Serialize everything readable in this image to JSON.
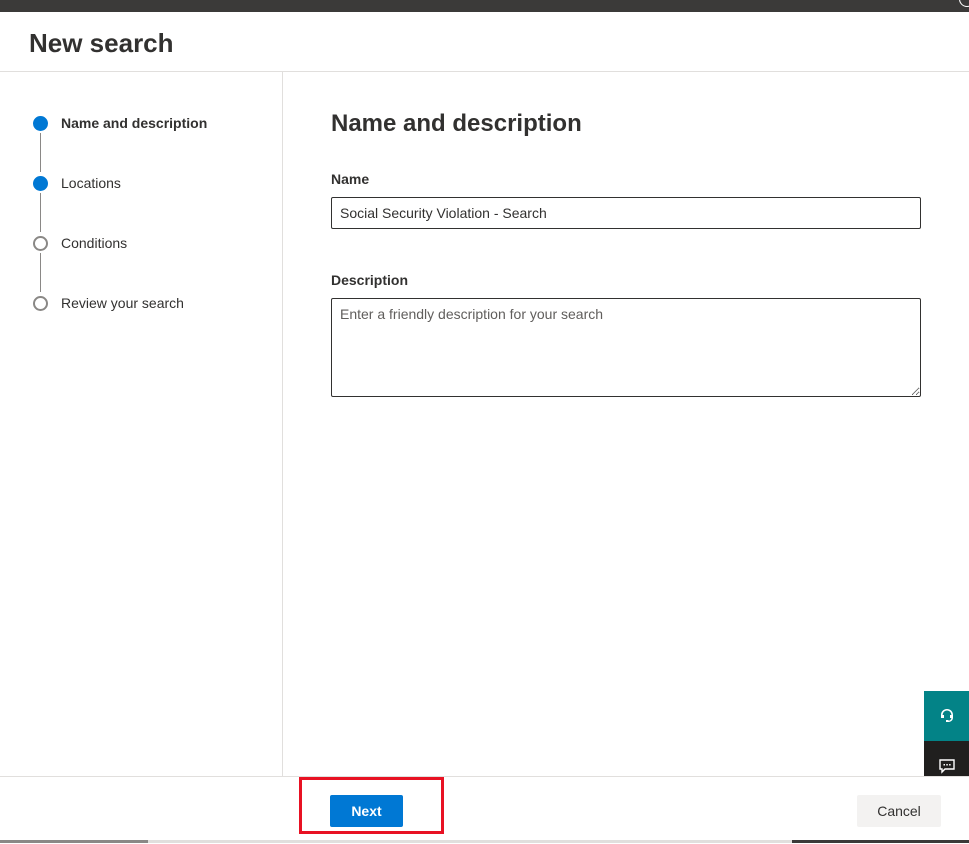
{
  "header": {
    "title": "New search"
  },
  "steps": [
    {
      "label": "Name and description",
      "state": "current"
    },
    {
      "label": "Locations",
      "state": "completed"
    },
    {
      "label": "Conditions",
      "state": "not-started"
    },
    {
      "label": "Review your search",
      "state": "not-started"
    }
  ],
  "main": {
    "section_title": "Name and description",
    "name_label": "Name",
    "name_value": "Social Security Violation - Search",
    "description_label": "Description",
    "description_placeholder": "Enter a friendly description for your search",
    "description_value": ""
  },
  "footer": {
    "next_label": "Next",
    "cancel_label": "Cancel"
  },
  "floating": {
    "help_icon": "headset-help-icon",
    "feedback_icon": "chat-feedback-icon"
  },
  "colors": {
    "accent": "#0078d4",
    "highlight": "#e81123",
    "help_bg": "#038387",
    "feedback_bg": "#201f1e"
  }
}
